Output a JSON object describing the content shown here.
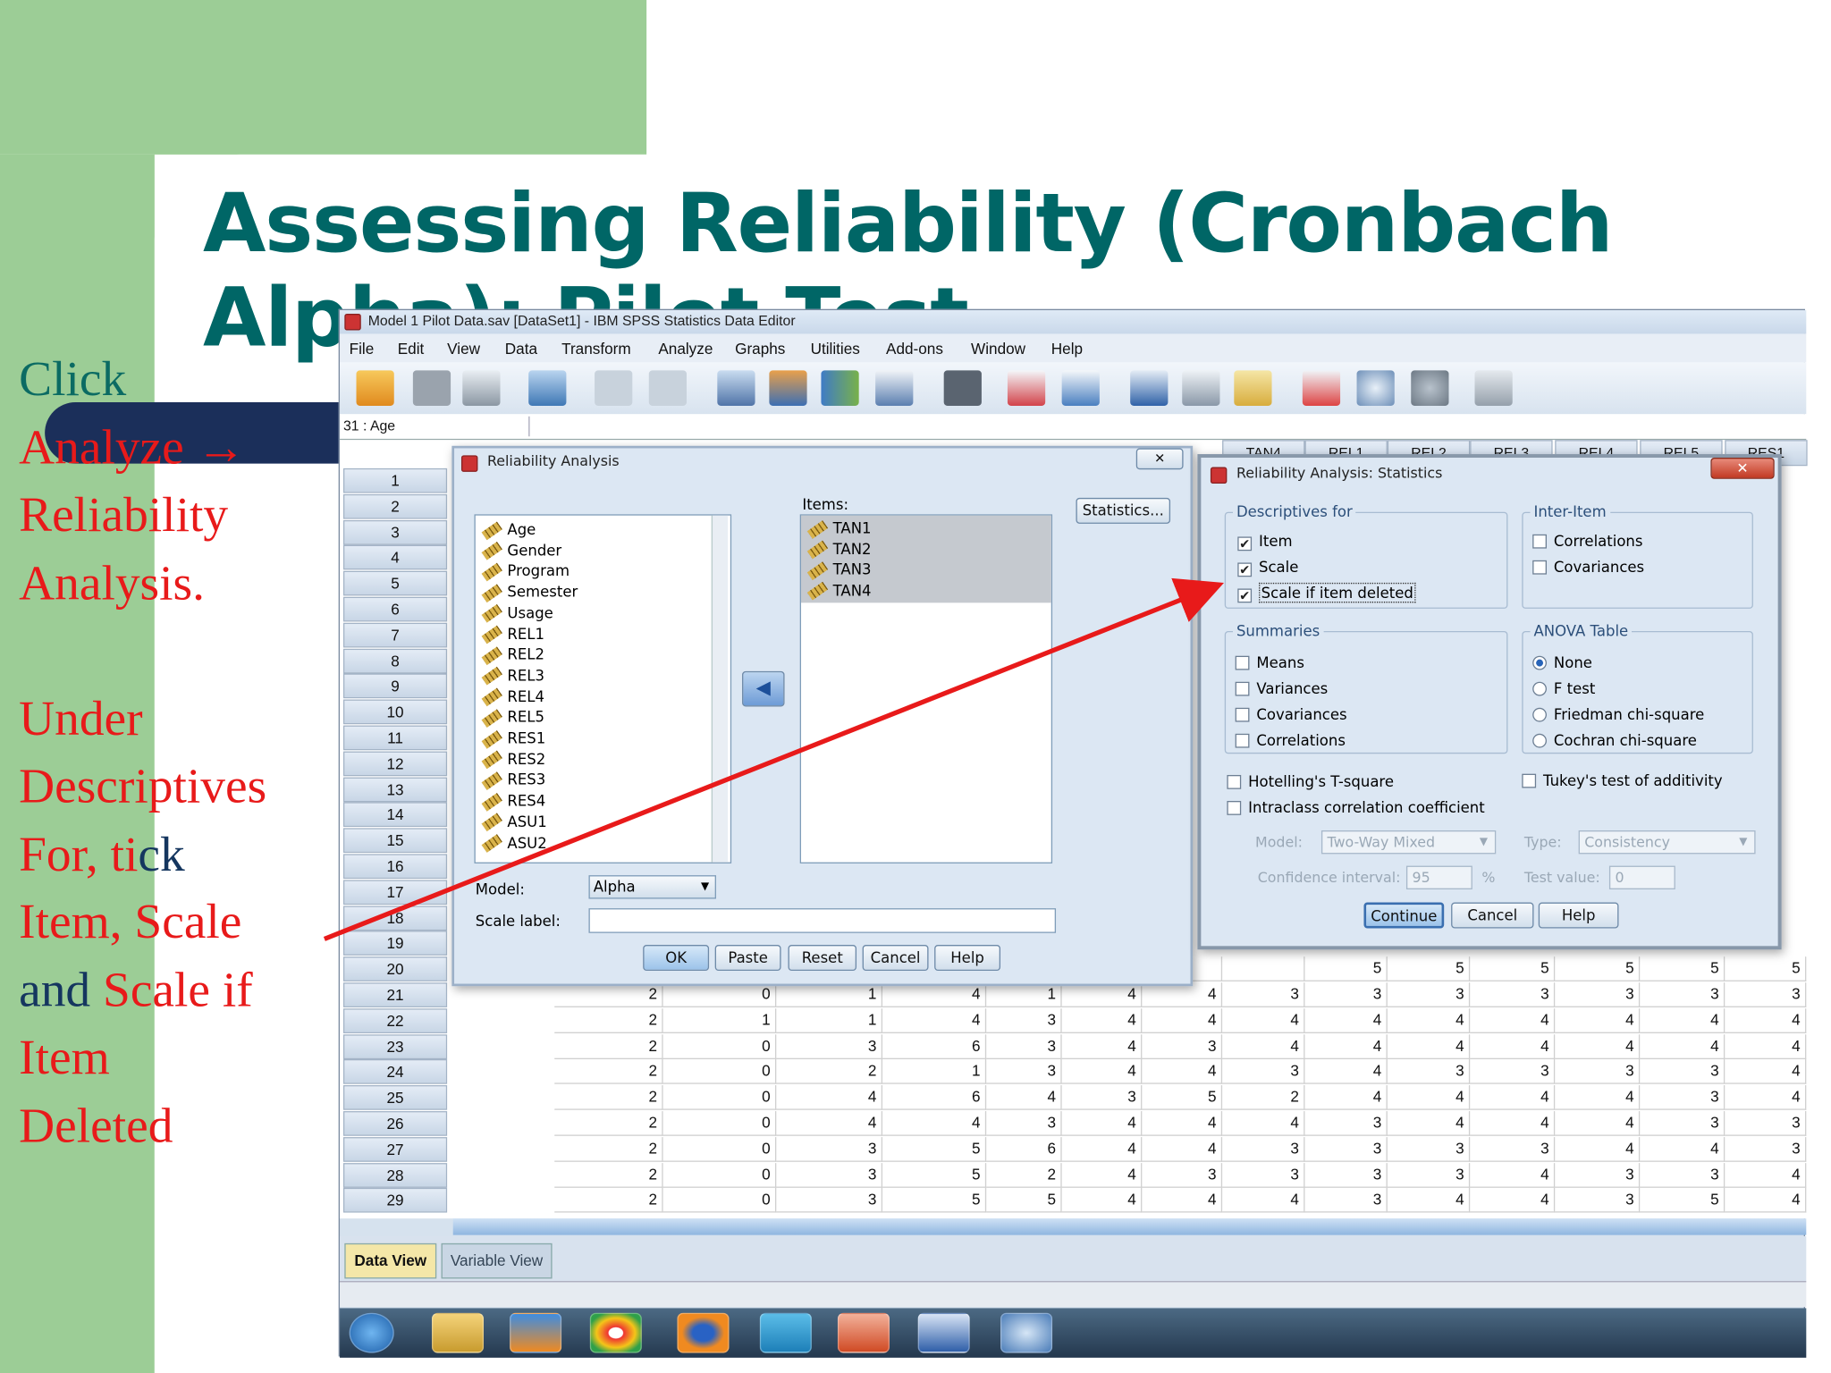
{
  "slide": {
    "title": "Assessing Reliability (Cronbach Alpha): Pilot Test",
    "instructions": {
      "l1": "Click",
      "l2": "Analyze →",
      "l3": "Reliability",
      "l4": "Analysis.",
      "l5": "Under",
      "l6": "Descriptives",
      "l7a": "For, ",
      "l7b": "ti",
      "l7c": "ck",
      "l8": "Item, Scale",
      "l9a": "and",
      "l9b": " Scale if",
      "l10": "Item",
      "l11": "Deleted"
    },
    "colors": {
      "title": "#006666",
      "red": "#e81a1a",
      "navy": "#15365f",
      "green": "#9ccd96"
    }
  },
  "spss": {
    "window_title": "Model 1 Pilot Data.sav [DataSet1] - IBM SPSS Statistics Data Editor",
    "menu": [
      "File",
      "Edit",
      "View",
      "Data",
      "Transform",
      "Analyze",
      "Graphs",
      "Utilities",
      "Add-ons",
      "Window",
      "Help"
    ],
    "toolbar_icons": [
      "open-icon",
      "save-icon",
      "print-icon",
      "dialog-recall-icon",
      "undo-icon",
      "redo-icon",
      "goto-case-icon",
      "goto-variable-icon",
      "variables-icon",
      "descriptives-icon",
      "find-icon",
      "insert-cases-icon",
      "insert-variable-icon",
      "split-file-icon",
      "weight-cases-icon",
      "select-cases-icon",
      "value-labels-icon",
      "use-sets-icon",
      "show-all-icon",
      "spell-check-icon"
    ],
    "cell_ref": "31 : Age",
    "rows_visible": [
      "1",
      "2",
      "3",
      "4",
      "5",
      "6",
      "7",
      "8",
      "9",
      "10",
      "11",
      "12",
      "13",
      "14",
      "15",
      "16",
      "17",
      "18",
      "19",
      "20",
      "21",
      "22",
      "23",
      "24",
      "25",
      "26",
      "27",
      "28",
      "29"
    ],
    "col_headers": [
      "TAN4",
      "REL1",
      "REL2",
      "REL3",
      "REL4",
      "REL5",
      "RES1"
    ],
    "data_rows": [
      {
        "row": "20",
        "vals": [
          "",
          "",
          "",
          "",
          "",
          "",
          "",
          "",
          "",
          "5",
          "5",
          "5",
          "5",
          "5",
          "5"
        ]
      },
      {
        "row": "21",
        "vals": [
          "2",
          "0",
          "1",
          "4",
          "1",
          "4",
          "4",
          "3",
          "3",
          "3",
          "3",
          "3",
          "3",
          "3"
        ]
      },
      {
        "row": "22",
        "vals": [
          "2",
          "1",
          "1",
          "4",
          "3",
          "4",
          "4",
          "4",
          "4",
          "4",
          "4",
          "4",
          "4",
          "4"
        ]
      },
      {
        "row": "23",
        "vals": [
          "2",
          "0",
          "3",
          "6",
          "3",
          "4",
          "3",
          "4",
          "4",
          "4",
          "4",
          "4",
          "4",
          "4"
        ]
      },
      {
        "row": "24",
        "vals": [
          "2",
          "0",
          "2",
          "1",
          "3",
          "4",
          "4",
          "3",
          "4",
          "3",
          "3",
          "3",
          "3",
          "4"
        ]
      },
      {
        "row": "25",
        "vals": [
          "2",
          "0",
          "4",
          "6",
          "4",
          "3",
          "5",
          "2",
          "4",
          "4",
          "4",
          "4",
          "3",
          "4"
        ]
      },
      {
        "row": "26",
        "vals": [
          "2",
          "0",
          "4",
          "4",
          "3",
          "4",
          "4",
          "4",
          "3",
          "4",
          "4",
          "4",
          "3",
          "3"
        ]
      },
      {
        "row": "27",
        "vals": [
          "2",
          "0",
          "3",
          "5",
          "6",
          "4",
          "4",
          "3",
          "3",
          "3",
          "3",
          "4",
          "4",
          "3"
        ]
      },
      {
        "row": "28",
        "vals": [
          "2",
          "0",
          "3",
          "5",
          "2",
          "4",
          "3",
          "3",
          "3",
          "3",
          "4",
          "3",
          "3",
          "4"
        ]
      },
      {
        "row": "29",
        "vals": [
          "2",
          "0",
          "3",
          "5",
          "5",
          "4",
          "4",
          "4",
          "3",
          "4",
          "4",
          "3",
          "5",
          "4"
        ]
      }
    ],
    "tabs": {
      "data_view": "Data View",
      "variable_view": "Variable View"
    },
    "taskbar_icons": [
      "start-icon",
      "explorer-icon",
      "media-icon",
      "chrome-icon",
      "firefox-icon",
      "network-icon",
      "powerpoint-icon",
      "word-icon",
      "spss-icon"
    ]
  },
  "reliability_dialog": {
    "title": "Reliability Analysis",
    "variables": [
      "Age",
      "Gender",
      "Program",
      "Semester",
      "Usage",
      "REL1",
      "REL2",
      "REL3",
      "REL4",
      "REL5",
      "RES1",
      "RES2",
      "RES3",
      "RES4",
      "ASU1",
      "ASU2"
    ],
    "items_label": "Items:",
    "items": [
      "TAN1",
      "TAN2",
      "TAN3",
      "TAN4"
    ],
    "statistics_button": "Statistics...",
    "model_label": "Model:",
    "model_value": "Alpha",
    "scale_label": "Scale label:",
    "buttons": [
      "OK",
      "Paste",
      "Reset",
      "Cancel",
      "Help"
    ]
  },
  "statistics_dialog": {
    "title": "Reliability Analysis: Statistics",
    "descriptives_for": {
      "label": "Descriptives for",
      "item": "Item",
      "scale": "Scale",
      "scale_if_deleted": "Scale if item deleted"
    },
    "inter_item": {
      "label": "Inter-Item",
      "correlations": "Correlations",
      "covariances": "Covariances"
    },
    "summaries": {
      "label": "Summaries",
      "means": "Means",
      "variances": "Variances",
      "covariances": "Covariances",
      "correlations": "Correlations"
    },
    "anova": {
      "label": "ANOVA Table",
      "none": "None",
      "ftest": "F test",
      "friedman": "Friedman chi-square",
      "cochran": "Cochran chi-square"
    },
    "hotelling": "Hotelling's T-square",
    "tukey": "Tukey's test of additivity",
    "intraclass": "Intraclass correlation coefficient",
    "model_label": "Model:",
    "model_value": "Two-Way Mixed",
    "type_label": "Type:",
    "type_value": "Consistency",
    "ci_label": "Confidence interval:",
    "ci_value": "95",
    "ci_unit": "%",
    "testvalue_label": "Test value:",
    "testvalue_value": "0",
    "buttons": {
      "continue": "Continue",
      "cancel": "Cancel",
      "help": "Help"
    }
  },
  "annotation": {
    "arrow_color": "#e81a1a"
  }
}
